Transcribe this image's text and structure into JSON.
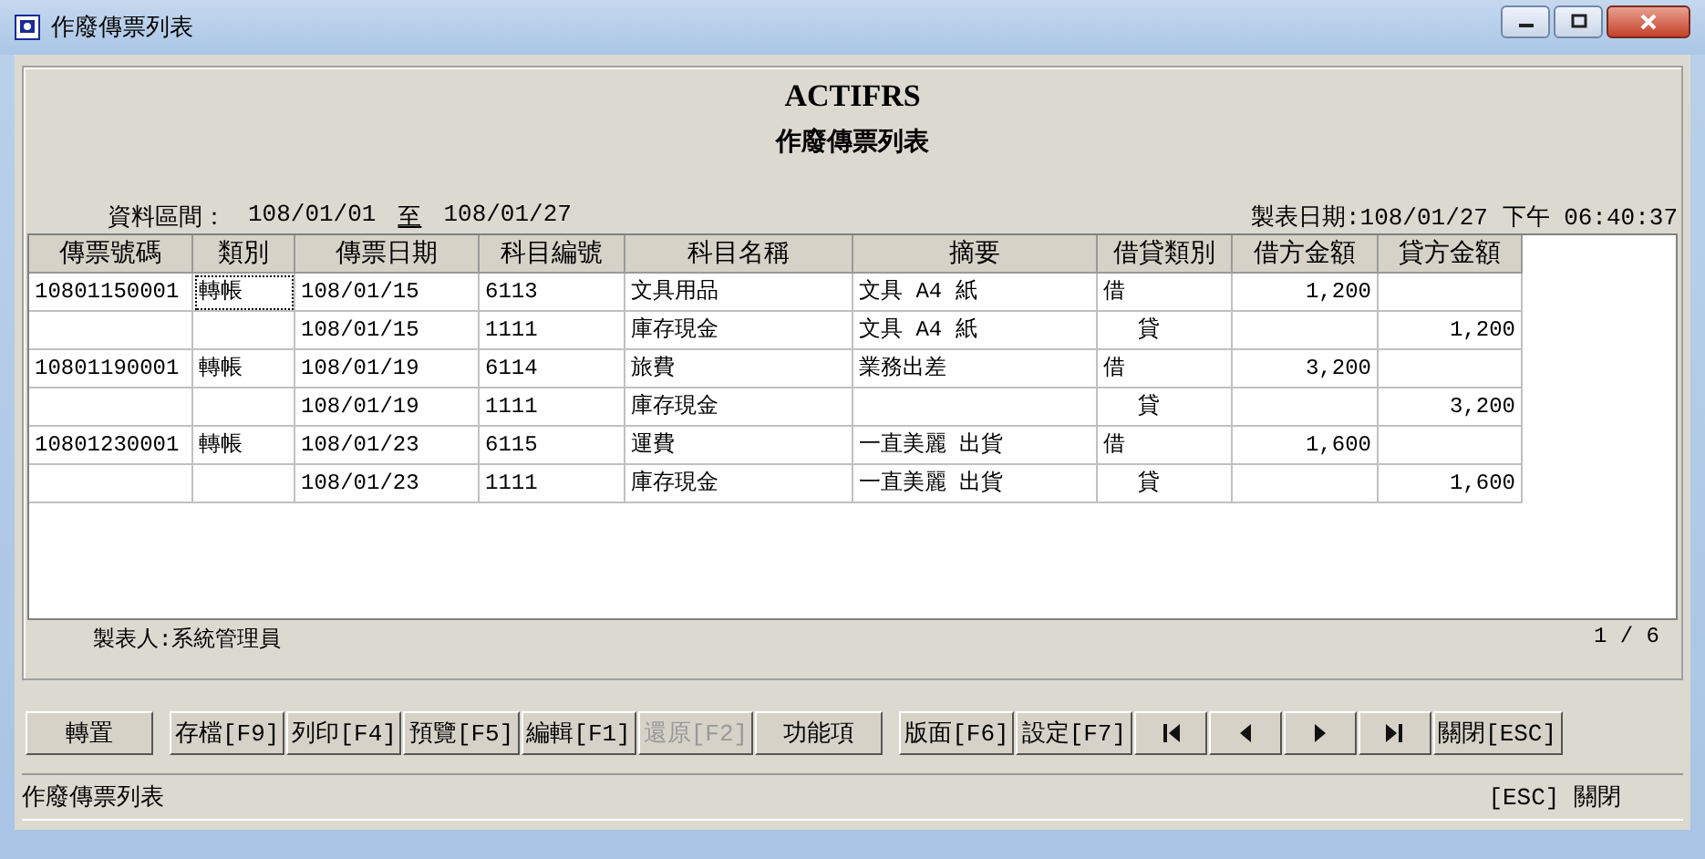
{
  "window": {
    "title": "作廢傳票列表"
  },
  "report": {
    "company": "ACTIFRS",
    "title": "作廢傳票列表",
    "range_label": "資料區間：",
    "range_from": "108/01/01",
    "range_sep": "至",
    "range_to": "108/01/27",
    "printed": "製表日期:108/01/27 下午 06:40:37",
    "maker": "製表人:系統管理員",
    "page": "1 / 6"
  },
  "table": {
    "columns": [
      "傳票號碼",
      "類別",
      "傳票日期",
      "科目編號",
      "科目名稱",
      "摘要",
      "借貸類別",
      "借方金額",
      "貸方金額"
    ],
    "rows": [
      {
        "kind": "debit",
        "focused": true,
        "cells": [
          "10801150001",
          "轉帳",
          "108/01/15",
          "6113",
          "文具用品",
          "文具 A4 紙",
          "借",
          "1,200",
          ""
        ]
      },
      {
        "kind": "credit",
        "focused": false,
        "cells": [
          "",
          "",
          "108/01/15",
          "1111",
          "庫存現金",
          "文具 A4 紙",
          "貸",
          "",
          "1,200"
        ]
      },
      {
        "kind": "debit",
        "focused": false,
        "cells": [
          "10801190001",
          "轉帳",
          "108/01/19",
          "6114",
          "旅費",
          "業務出差",
          "借",
          "3,200",
          ""
        ]
      },
      {
        "kind": "credit",
        "focused": false,
        "cells": [
          "",
          "",
          "108/01/19",
          "1111",
          "庫存現金",
          "",
          "貸",
          "",
          "3,200"
        ]
      },
      {
        "kind": "debit",
        "focused": false,
        "cells": [
          "10801230001",
          "轉帳",
          "108/01/23",
          "6115",
          "運費",
          "一直美麗 出貨",
          "借",
          "1,600",
          ""
        ]
      },
      {
        "kind": "credit",
        "focused": false,
        "cells": [
          "",
          "",
          "108/01/23",
          "1111",
          "庫存現金",
          "一直美麗 出貨",
          "貸",
          "",
          "1,600"
        ]
      }
    ]
  },
  "buttons": [
    {
      "kind": "text",
      "label": "轉置",
      "disabled": false
    },
    {
      "kind": "text",
      "label": "存檔[F9]",
      "disabled": false
    },
    {
      "kind": "text",
      "label": "列印[F4]",
      "disabled": false
    },
    {
      "kind": "text",
      "label": "預覽[F5]",
      "disabled": false
    },
    {
      "kind": "text",
      "label": "編輯[F1]",
      "disabled": false
    },
    {
      "kind": "text",
      "label": "還原[F2]",
      "disabled": true
    },
    {
      "kind": "text",
      "label": "功能項",
      "disabled": false
    },
    {
      "kind": "text",
      "label": "版面[F6]",
      "disabled": false
    },
    {
      "kind": "text",
      "label": "設定[F7]",
      "disabled": false
    },
    {
      "kind": "first",
      "disabled": false
    },
    {
      "kind": "prev",
      "disabled": false
    },
    {
      "kind": "next",
      "disabled": false
    },
    {
      "kind": "last",
      "disabled": false
    },
    {
      "kind": "text",
      "label": "關閉[ESC]",
      "disabled": false
    }
  ],
  "status_bar": {
    "left": "作廢傳票列表",
    "right": "[ESC] 關閉"
  }
}
